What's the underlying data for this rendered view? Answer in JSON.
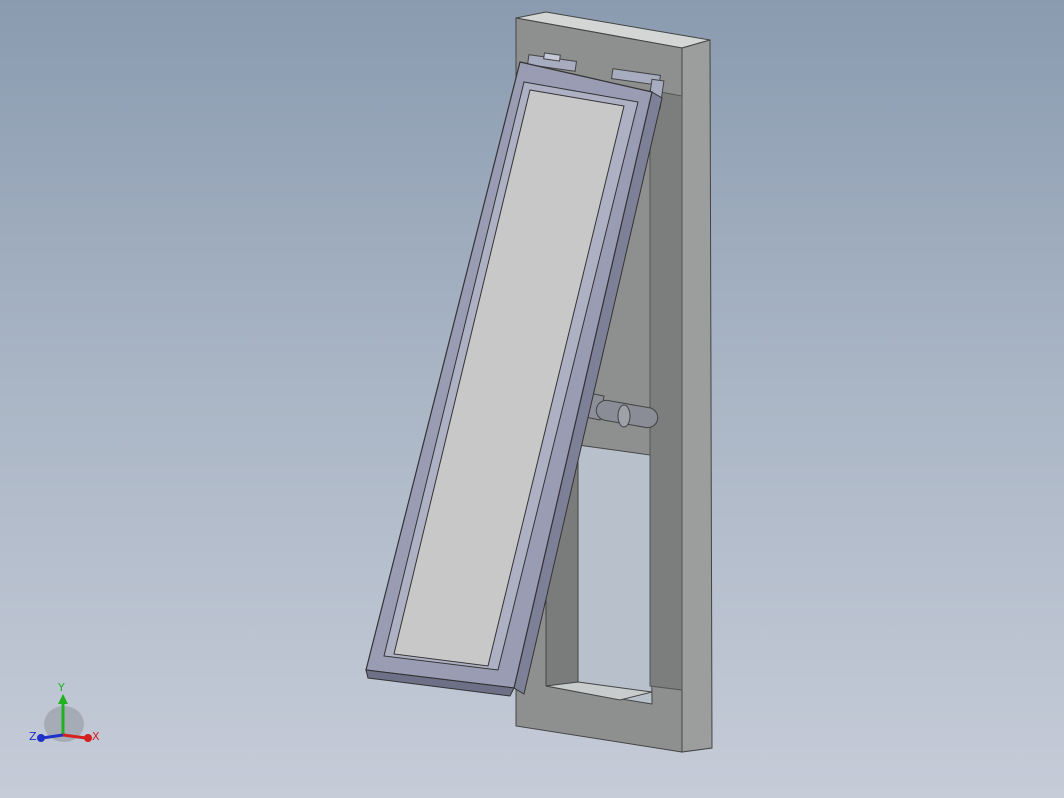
{
  "viewport": {
    "background_top": "#8a9bb0",
    "background_bottom": "#c6ccd8"
  },
  "model": {
    "frame_color": "#8a8c8c",
    "sash_color": "#9a9cb4",
    "glass_color": "#c8c8c8",
    "hinge_color": "#a8acc0",
    "stay_color": "#7c7e88"
  },
  "triad": {
    "x_label": "X",
    "y_label": "Y",
    "z_label": "Z",
    "x_color": "#d42020",
    "y_color": "#20b020",
    "z_color": "#2030c8"
  }
}
